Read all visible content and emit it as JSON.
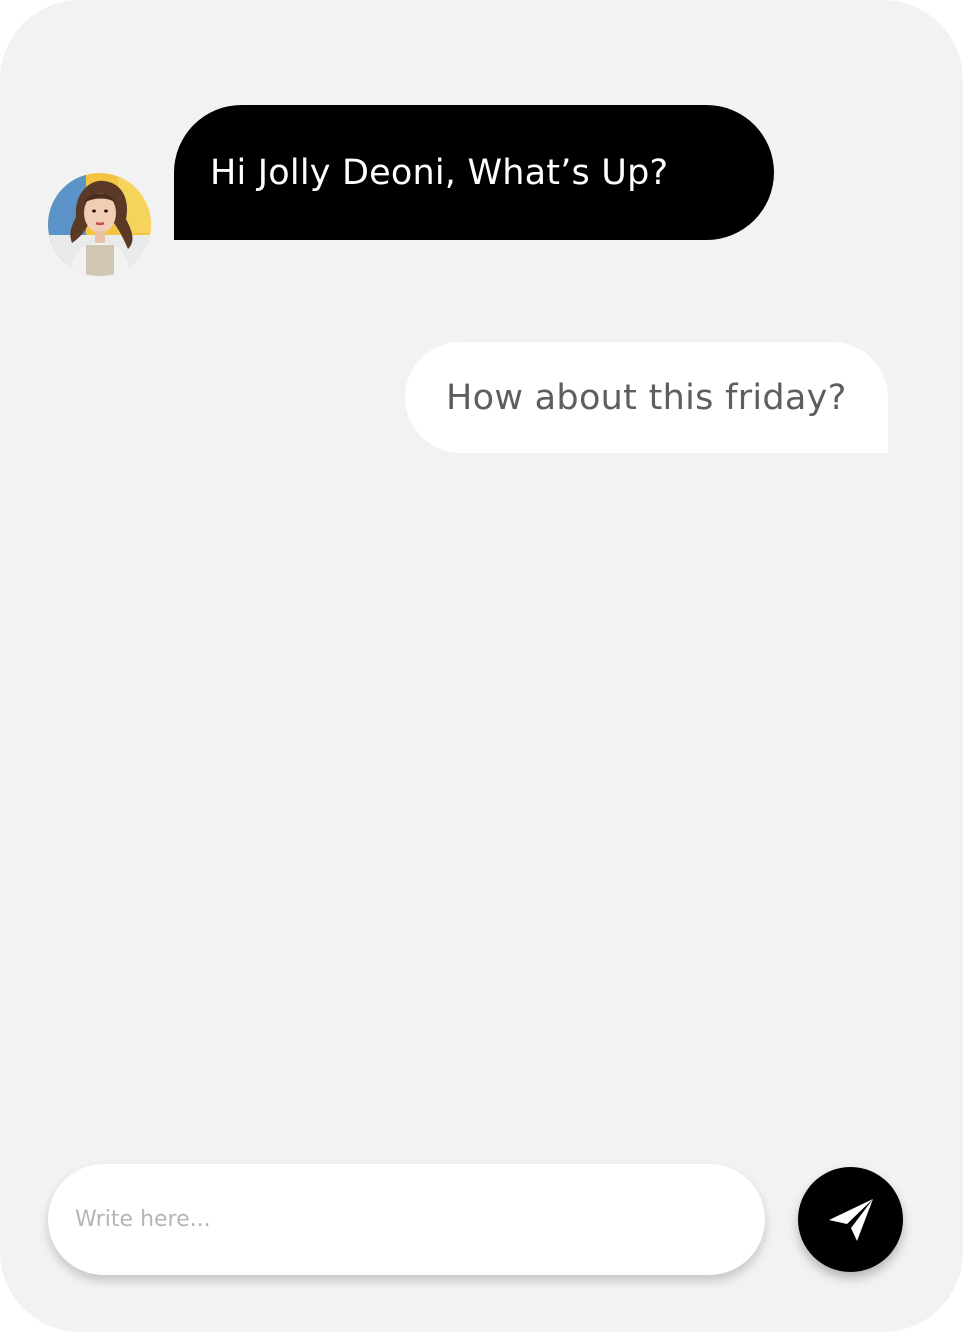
{
  "messages": {
    "incoming": {
      "text": "Hi Jolly Deoni, What’s Up?"
    },
    "outgoing": {
      "text": "How about this friday?"
    }
  },
  "composer": {
    "placeholder": "Write here...",
    "value": "",
    "send_icon": "send-icon"
  },
  "colors": {
    "background": "#f2f2f2",
    "incoming_bubble": "#000000",
    "outgoing_bubble": "#ffffff",
    "send_button": "#000000"
  }
}
